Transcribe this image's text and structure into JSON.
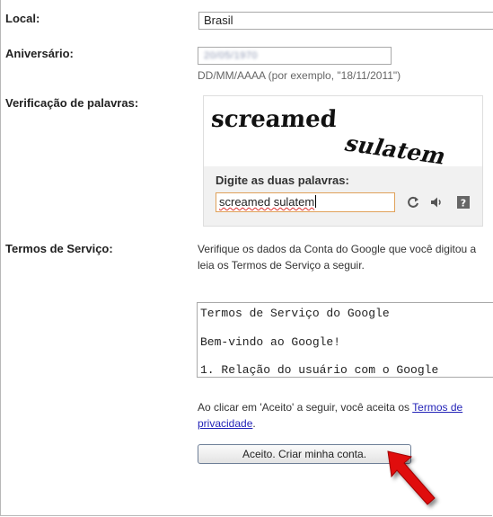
{
  "fields": {
    "local_label": "Local:",
    "local_value": "Brasil",
    "birthday_label": "Aniversário:",
    "birthday_value": "20/05/1970",
    "birthday_hint": "DD/MM/AAAA (por exemplo, \"18/11/2011\")",
    "verification_label": "Verificação de palavras:",
    "terms_label": "Termos de Serviço:"
  },
  "captcha": {
    "word1": "screamed",
    "word2": "sulatem",
    "prompt": "Digite as duas palavras:",
    "input_value": "screamed sulatem",
    "icons": [
      "refresh-icon",
      "audio-icon",
      "help-icon"
    ]
  },
  "terms": {
    "intro_line1": "Verifique os dados da Conta do Google que você digitou a",
    "intro_line2": "leia os Termos de Serviço a seguir.",
    "tos_lines": [
      "Termos de Serviço do Google",
      "Bem-vindo ao Google!",
      "1. Relação do usuário com o Google"
    ],
    "accept_prefix": "Ao clicar em 'Aceito' a seguir, você aceita os ",
    "accept_link1": "Termos de",
    "accept_link2": "privacidade",
    "accept_suffix": "."
  },
  "buttons": {
    "submit_label": "Aceito. Criar minha conta."
  },
  "colors": {
    "link": "#2424b8",
    "captcha_focus_border": "#e0a25a",
    "pointer_arrow": "#e01010"
  }
}
